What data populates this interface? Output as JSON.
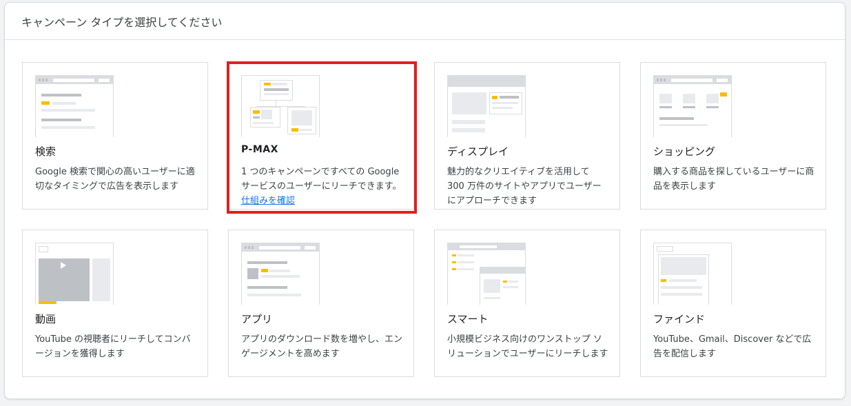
{
  "panel": {
    "title": "キャンペーン タイプを選択してください"
  },
  "cards": [
    {
      "key": "search",
      "title": "検索",
      "desc": "Google 検索で関心の高いユーザーに適切なタイミングで広告を表示します",
      "link": ""
    },
    {
      "key": "pmax",
      "title": "P-MAX",
      "desc": "1 つのキャンペーンですべての Google サービスのユーザーにリーチできます。",
      "link": "仕組みを確認"
    },
    {
      "key": "display",
      "title": "ディスプレイ",
      "desc": "魅力的なクリエイティブを活用して 300 万件のサイトやアプリでユーザーにアプローチできます",
      "link": ""
    },
    {
      "key": "shopping",
      "title": "ショッピング",
      "desc": "購入する商品を探しているユーザーに商品を表示します",
      "link": ""
    },
    {
      "key": "video",
      "title": "動画",
      "desc": "YouTube の視聴者にリーチしてコンバージョンを獲得します",
      "link": ""
    },
    {
      "key": "app",
      "title": "アプリ",
      "desc": "アプリのダウンロード数を増やし、エンゲージメントを高めます",
      "link": ""
    },
    {
      "key": "smart",
      "title": "スマート",
      "desc": "小規模ビジネス向けのワンストップ ソリューションでユーザーにリーチします",
      "link": ""
    },
    {
      "key": "discovery",
      "title": "ファインド",
      "desc": "YouTube、Gmail、Discover などで広告を配信します",
      "link": ""
    }
  ],
  "colors": {
    "accent_yellow": "#fbbc04",
    "link_blue": "#1a73e8",
    "highlight_red": "#e02020"
  },
  "icons": {
    "video_play": "play-icon",
    "app_download": "download-icon"
  }
}
